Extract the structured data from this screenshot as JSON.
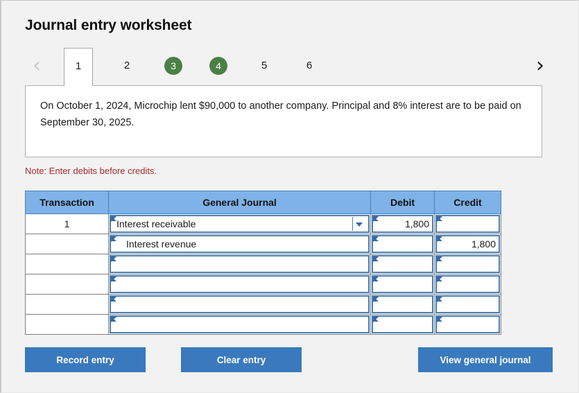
{
  "page": {
    "title": "Journal entry worksheet",
    "note": "Note: Enter debits before credits.",
    "scenario": "On October 1, 2024, Microchip lent $90,000 to another company. Principal and 8% interest are to be paid on September 30, 2025."
  },
  "nav": {
    "prev_icon": "chevron-left-icon",
    "next_icon": "chevron-right-icon",
    "prev_glyph": "‹",
    "next_glyph": "›"
  },
  "tabs": [
    {
      "label": "1",
      "state": "active",
      "style": "plain"
    },
    {
      "label": "2",
      "state": "inactive",
      "style": "plain"
    },
    {
      "label": "3",
      "state": "completed",
      "style": "circle"
    },
    {
      "label": "4",
      "state": "completed",
      "style": "circle"
    },
    {
      "label": "5",
      "state": "inactive",
      "style": "plain"
    },
    {
      "label": "6",
      "state": "inactive",
      "style": "plain"
    }
  ],
  "table": {
    "headers": {
      "transaction": "Transaction",
      "general_journal": "General Journal",
      "debit": "Debit",
      "credit": "Credit"
    },
    "rows": [
      {
        "transaction": "1",
        "account": "Interest receivable",
        "indent": false,
        "dropdown": true,
        "debit": "1,800",
        "credit": ""
      },
      {
        "transaction": "",
        "account": "Interest revenue",
        "indent": true,
        "dropdown": false,
        "debit": "",
        "credit": "1,800"
      },
      {
        "transaction": "",
        "account": "",
        "indent": false,
        "dropdown": false,
        "debit": "",
        "credit": ""
      },
      {
        "transaction": "",
        "account": "",
        "indent": false,
        "dropdown": false,
        "debit": "",
        "credit": ""
      },
      {
        "transaction": "",
        "account": "",
        "indent": false,
        "dropdown": false,
        "debit": "",
        "credit": ""
      },
      {
        "transaction": "",
        "account": "",
        "indent": false,
        "dropdown": false,
        "debit": "",
        "credit": ""
      }
    ]
  },
  "buttons": {
    "record": "Record entry",
    "clear": "Clear entry",
    "view": "View general journal"
  },
  "colors": {
    "header_blue": "#7eb2e8",
    "button_blue": "#3a79bd",
    "completed_green": "#4a8045",
    "note_red": "#a92d2d",
    "field_border_blue": "#4a7fb5",
    "page_background": "#f2f2f2"
  }
}
